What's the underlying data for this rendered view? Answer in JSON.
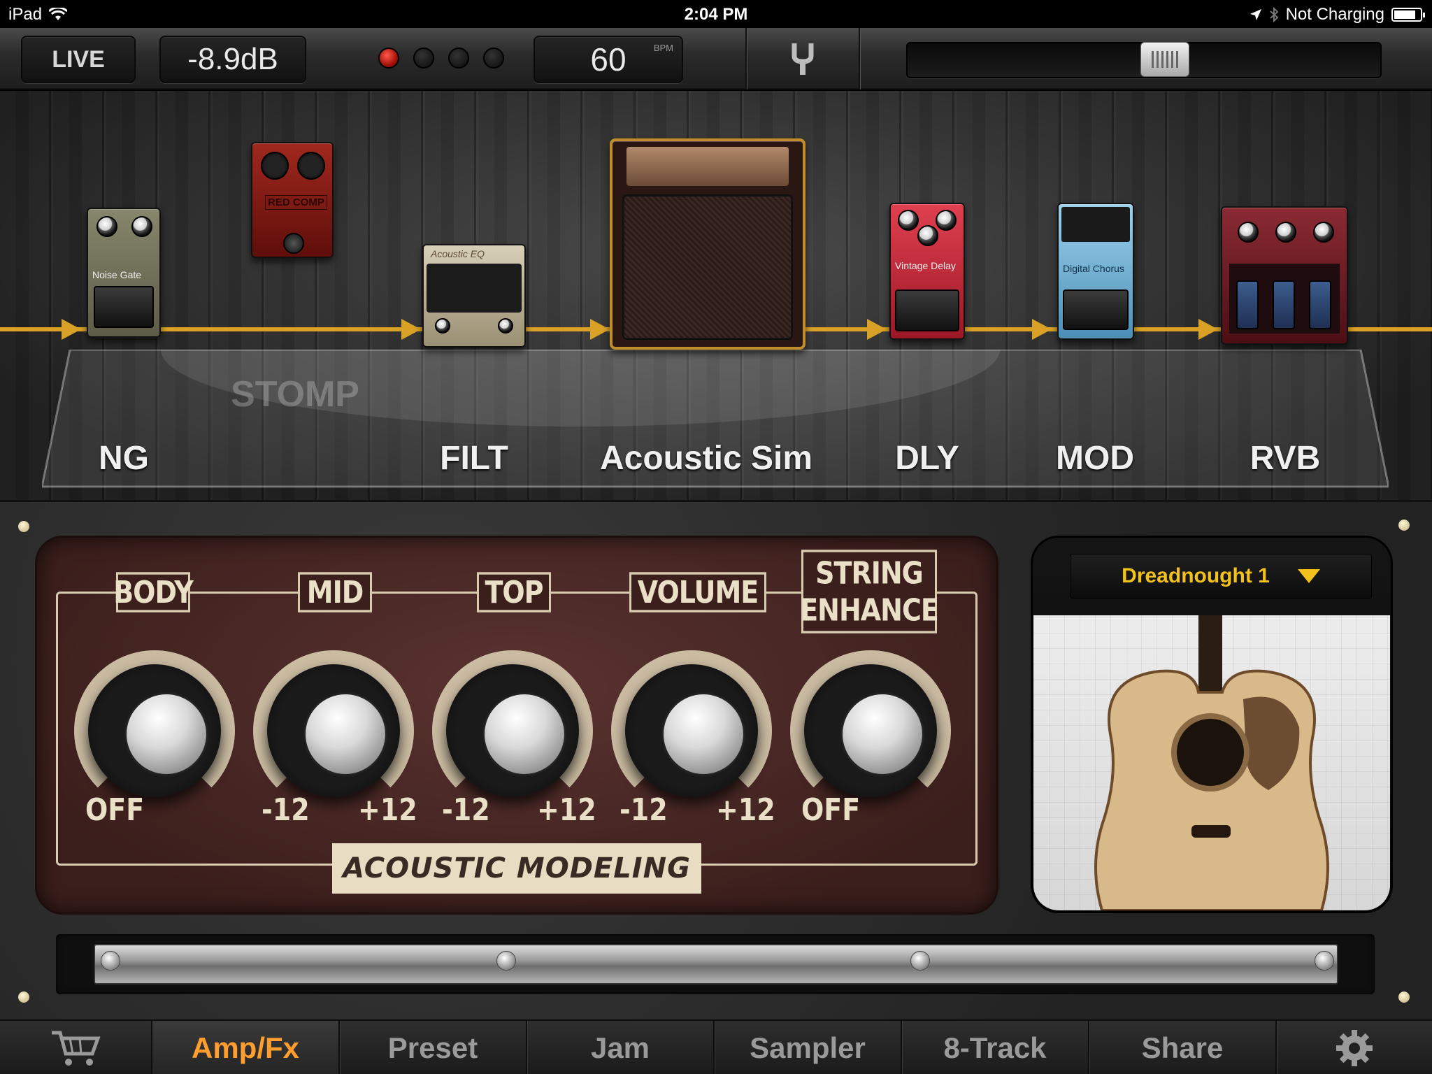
{
  "status_bar": {
    "device": "iPad",
    "time": "2:04 PM",
    "charging": "Not Charging",
    "icons": [
      "wifi-icon",
      "location-icon",
      "bluetooth-icon",
      "battery-icon"
    ]
  },
  "toolbar": {
    "live_label": "LIVE",
    "level": "-8.9dB",
    "bpm_value": "60",
    "bpm_unit": "BPM",
    "record_leds": 4,
    "active_led": 0,
    "tuner_icon": "tuning-fork-icon",
    "master_slider_value": 0.55
  },
  "signal_chain": {
    "ghost_label": "STOMP",
    "slots": [
      {
        "label": "NG",
        "pedal_text": "Noise Gate"
      },
      {
        "label": "",
        "pedal_text": "RED COMP"
      },
      {
        "label": "FILT",
        "pedal_text": "Acoustic EQ"
      },
      {
        "label": "Acoustic Sim",
        "pedal_text": ""
      },
      {
        "label": "DLY",
        "pedal_text": "Vintage Delay"
      },
      {
        "label": "MOD",
        "pedal_text": "Digital Chorus"
      },
      {
        "label": "RVB",
        "pedal_text": ""
      }
    ]
  },
  "amp_panel": {
    "brand": "ACOUSTIC MODELING",
    "controls": [
      {
        "name": "BODY",
        "min": "OFF",
        "max": ""
      },
      {
        "name": "MID",
        "min": "-12",
        "max": "+12"
      },
      {
        "name": "TOP",
        "min": "-12",
        "max": "+12"
      },
      {
        "name": "VOLUME",
        "min": "-12",
        "max": "+12"
      },
      {
        "name_line1": "STRING",
        "name_line2": "ENHANCE",
        "min": "OFF",
        "max": ""
      }
    ]
  },
  "guitar_selector": {
    "selected": "Dreadnought 1"
  },
  "tabs": [
    {
      "label": "",
      "icon": "cart-icon"
    },
    {
      "label": "Amp/Fx",
      "active": true
    },
    {
      "label": "Preset"
    },
    {
      "label": "Jam"
    },
    {
      "label": "Sampler"
    },
    {
      "label": "8-Track"
    },
    {
      "label": "Share"
    },
    {
      "label": "",
      "icon": "gear-icon"
    }
  ],
  "colors": {
    "accent": "#ff9d2e",
    "signal": "#d9a227",
    "selector_text": "#f3c11b",
    "panel_bg": "#3a1e1b",
    "panel_ink": "#eae0c8"
  }
}
